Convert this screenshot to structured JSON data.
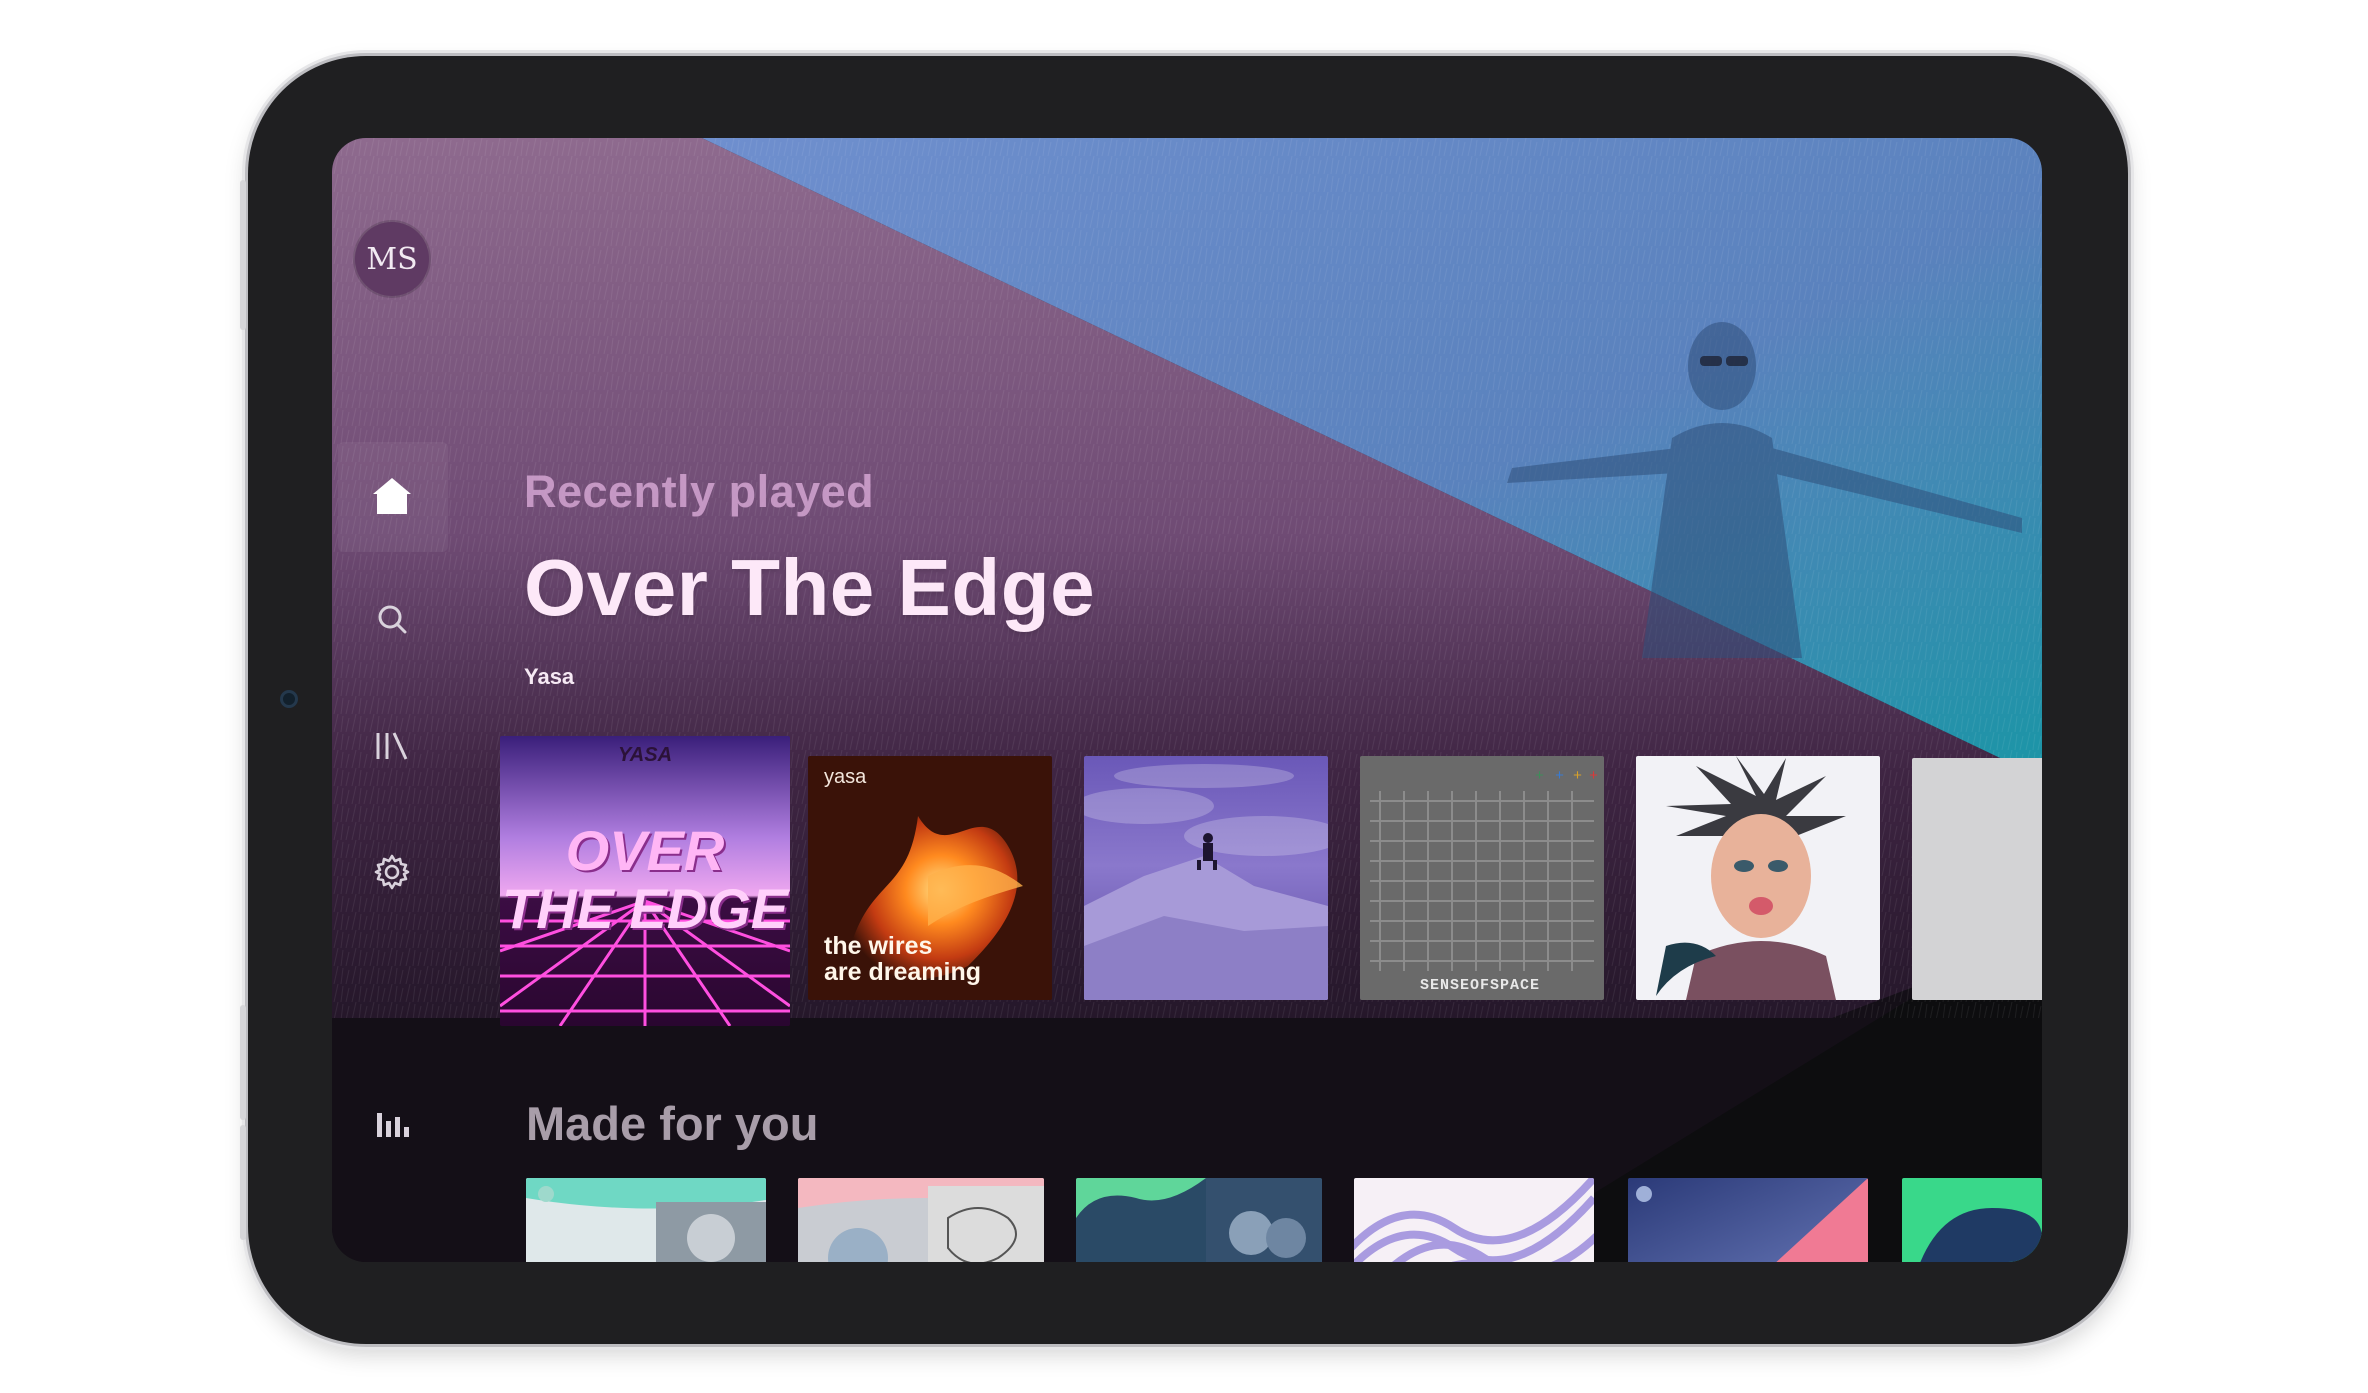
{
  "user": {
    "initials": "MS"
  },
  "nav": {
    "items": [
      {
        "id": "home",
        "icon": "home-icon"
      },
      {
        "id": "search",
        "icon": "search-icon"
      },
      {
        "id": "library",
        "icon": "library-icon"
      },
      {
        "id": "settings",
        "icon": "gear-icon"
      },
      {
        "id": "stats",
        "icon": "bar-chart-icon"
      }
    ],
    "active": "home"
  },
  "hero": {
    "kicker": "Recently played",
    "title": "Over The Edge",
    "artist": "Yasa"
  },
  "recently_played": [
    {
      "cover_lines": [
        "YASA",
        "OVER",
        "THE EDGE"
      ],
      "theme": "synthwave grid"
    },
    {
      "cover_label": "yasa",
      "cover_lines": [
        "the wires",
        "are dreaming"
      ],
      "theme": "orange flames"
    },
    {
      "theme": "purple mountain climber"
    },
    {
      "cover_label": "SENSEOFSPACE",
      "theme": "grey letter grid"
    },
    {
      "theme": "spiky hair portrait"
    },
    {
      "theme": "blank grey"
    }
  ],
  "made_for_you": {
    "title": "Made for you",
    "tiles": [
      {
        "theme": "teal mix portrait"
      },
      {
        "theme": "pink sketch mix"
      },
      {
        "theme": "green blue duo"
      },
      {
        "theme": "purple waves"
      },
      {
        "theme": "blue pink gradient"
      },
      {
        "theme": "green navy shape"
      }
    ]
  },
  "colors": {
    "background_dark": "#120e16",
    "accent_purple": "#6b4a72",
    "accent_blue": "#5a7fc0",
    "accent_teal": "#1b8ca0",
    "hero_text": "#fde8f8",
    "kicker_text": "#d7a8d5"
  }
}
